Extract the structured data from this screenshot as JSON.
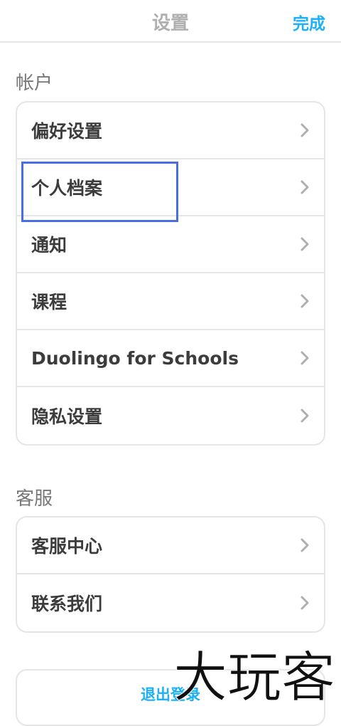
{
  "header": {
    "title": "设置",
    "done_label": "完成"
  },
  "account": {
    "label": "帐户",
    "items": [
      {
        "label": "偏好设置"
      },
      {
        "label": "个人档案"
      },
      {
        "label": "通知"
      },
      {
        "label": "课程"
      },
      {
        "label": "Duolingo for Schools"
      },
      {
        "label": "隐私设置"
      }
    ]
  },
  "support": {
    "label": "客服",
    "items": [
      {
        "label": "客服中心"
      },
      {
        "label": "联系我们"
      }
    ]
  },
  "logout": {
    "label": "退出登录"
  },
  "watermark": {
    "text": "大玩客"
  },
  "colors": {
    "accent": "#1cb0f6",
    "highlight": "#4a6de5",
    "border": "#e5e5e5",
    "text": "#3c3c3c",
    "muted": "#afafaf"
  },
  "icons": {
    "row_chevron": "chevron-right-icon"
  }
}
